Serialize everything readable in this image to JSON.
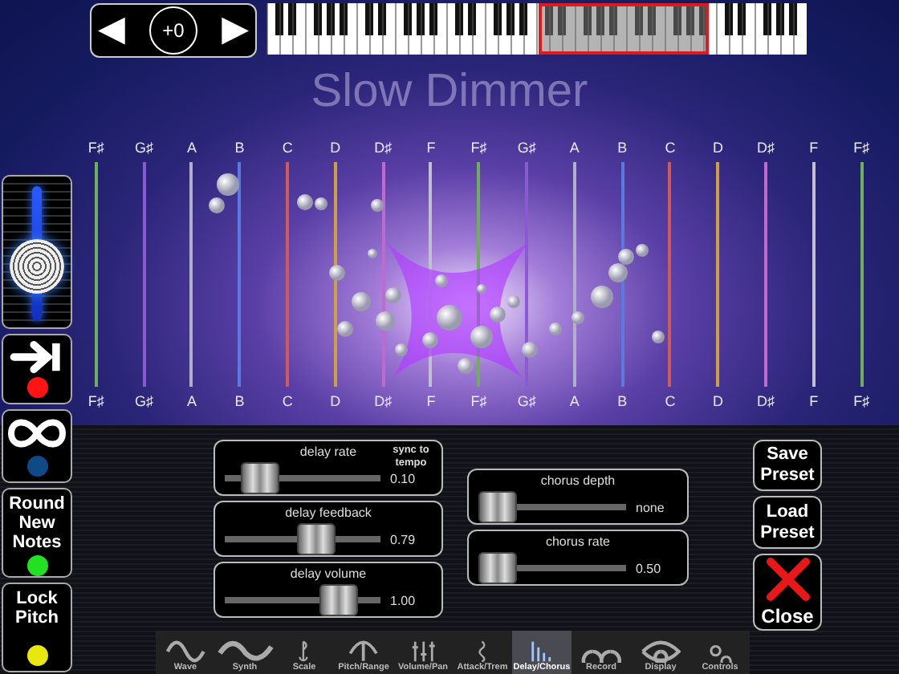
{
  "transpose": {
    "prev": "◀",
    "value": "+0",
    "next": "▶"
  },
  "preset_title": "Slow Dimmer",
  "strings": [
    {
      "top": "F♯",
      "bottom": "F♯",
      "color": "#6fae5a"
    },
    {
      "top": "G♯",
      "bottom": "G♯",
      "color": "#8a5ad0"
    },
    {
      "top": "A",
      "bottom": "A",
      "color": "#b0b0c8"
    },
    {
      "top": "B",
      "bottom": "B",
      "color": "#5a7ae0"
    },
    {
      "top": "C",
      "bottom": "C",
      "color": "#d05a5a"
    },
    {
      "top": "D",
      "bottom": "D",
      "color": "#d0a040"
    },
    {
      "top": "D♯",
      "bottom": "D♯",
      "color": "#c06ad0"
    },
    {
      "top": "F",
      "bottom": "F",
      "color": "#c0c0d0"
    },
    {
      "top": "F♯",
      "bottom": "F♯",
      "color": "#6fae5a"
    },
    {
      "top": "G♯",
      "bottom": "G♯",
      "color": "#8a5ad0"
    },
    {
      "top": "A",
      "bottom": "A",
      "color": "#b0b0c8"
    },
    {
      "top": "B",
      "bottom": "B",
      "color": "#5a7ae0"
    },
    {
      "top": "C",
      "bottom": "C",
      "color": "#d05a5a"
    },
    {
      "top": "D",
      "bottom": "D",
      "color": "#d0a040"
    },
    {
      "top": "D♯",
      "bottom": "D♯",
      "color": "#c06ad0"
    },
    {
      "top": "F",
      "bottom": "F",
      "color": "#c0c0d0"
    },
    {
      "top": "F♯",
      "bottom": "F♯",
      "color": "#6fae5a"
    }
  ],
  "side_slider": {
    "level": 0.4
  },
  "side_buttons": [
    {
      "kind": "arrow",
      "color": "#ff1414"
    },
    {
      "kind": "loop",
      "color": "#0d4a86"
    },
    {
      "kind": "text",
      "label": "Round New Notes",
      "color": "#22e022"
    },
    {
      "kind": "text",
      "label": "Lock Pitch",
      "color": "#e8e810"
    }
  ],
  "delay_sliders": [
    {
      "label": "delay rate",
      "note": "sync to tempo",
      "value": "0.10",
      "level": 0.15
    },
    {
      "label": "delay feedback",
      "value": "0.79",
      "level": 0.65
    },
    {
      "label": "delay volume",
      "value": "1.00",
      "level": 0.85
    }
  ],
  "chorus_sliders": [
    {
      "label": "chorus depth",
      "value": "none",
      "level": 0.0
    },
    {
      "label": "chorus rate",
      "value": "0.50",
      "level": 0.0
    }
  ],
  "preset_buttons": [
    {
      "label": "Save Preset"
    },
    {
      "label": "Load Preset"
    }
  ],
  "close_button": {
    "label": "Close"
  },
  "tabs": [
    {
      "label": "Wave",
      "selected": false
    },
    {
      "label": "Synth",
      "selected": false
    },
    {
      "label": "Scale",
      "selected": false
    },
    {
      "label": "Pitch/Range",
      "selected": false
    },
    {
      "label": "Volume/Pan",
      "selected": false
    },
    {
      "label": "Attack/Trem",
      "selected": false
    },
    {
      "label": "Delay/Chorus",
      "selected": true
    },
    {
      "label": "Record",
      "selected": false
    },
    {
      "label": "Display",
      "selected": false
    },
    {
      "label": "Controls",
      "selected": false
    }
  ]
}
